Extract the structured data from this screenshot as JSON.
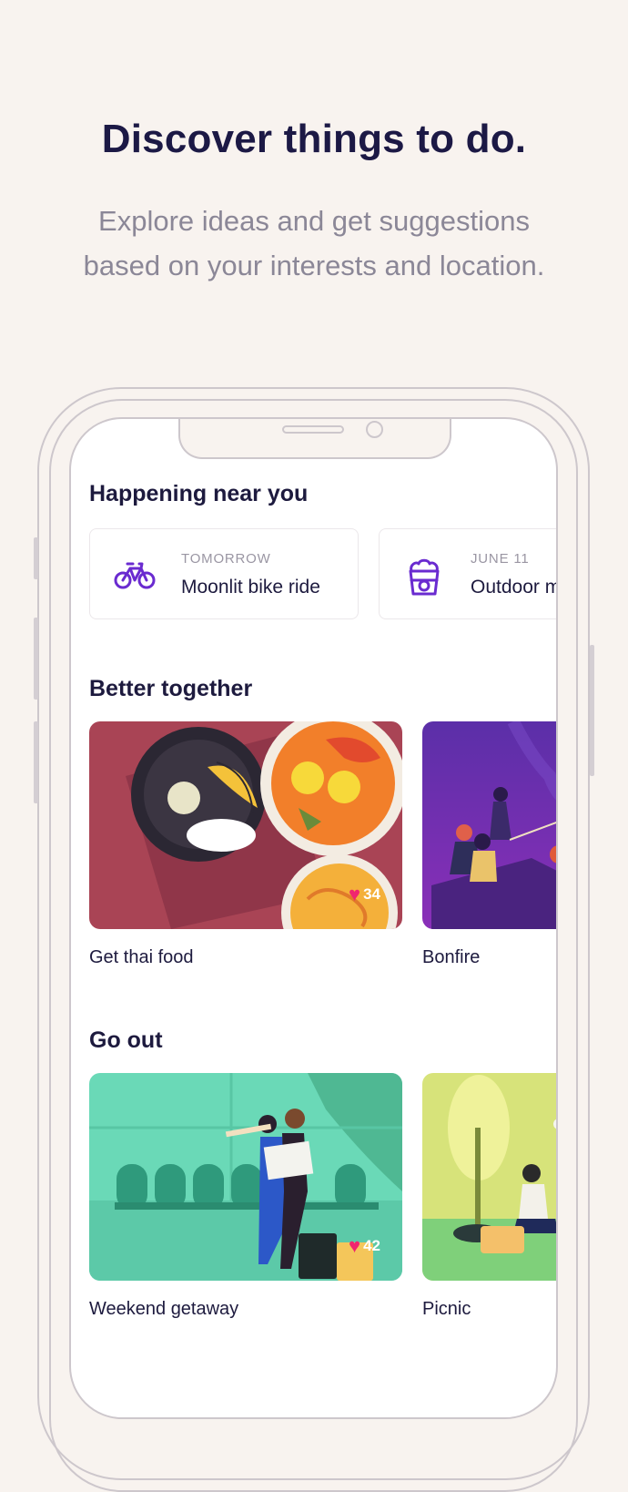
{
  "hero": {
    "title": "Discover things to do.",
    "subtitle_line1": "Explore ideas and get suggestions",
    "subtitle_line2": "based on your interests and location."
  },
  "sections": {
    "happening": {
      "title": "Happening near you",
      "events": [
        {
          "date": "TOMORROW",
          "name": "Moonlit bike ride",
          "icon": "bicycle-icon"
        },
        {
          "date": "JUNE 11",
          "name": "Outdoor m",
          "icon": "popcorn-icon"
        }
      ]
    },
    "better_together": {
      "title": "Better together",
      "cards": [
        {
          "label": "Get thai food",
          "likes": "34"
        },
        {
          "label": "Bonfire"
        }
      ]
    },
    "go_out": {
      "title": "Go out",
      "cards": [
        {
          "label": "Weekend getaway",
          "likes": "42"
        },
        {
          "label": "Picnic"
        }
      ]
    }
  },
  "colors": {
    "background": "#f8f3ef",
    "accent_purple": "#6a2bd0",
    "heart_pink": "#f0266f",
    "title_navy": "#1c1945"
  }
}
